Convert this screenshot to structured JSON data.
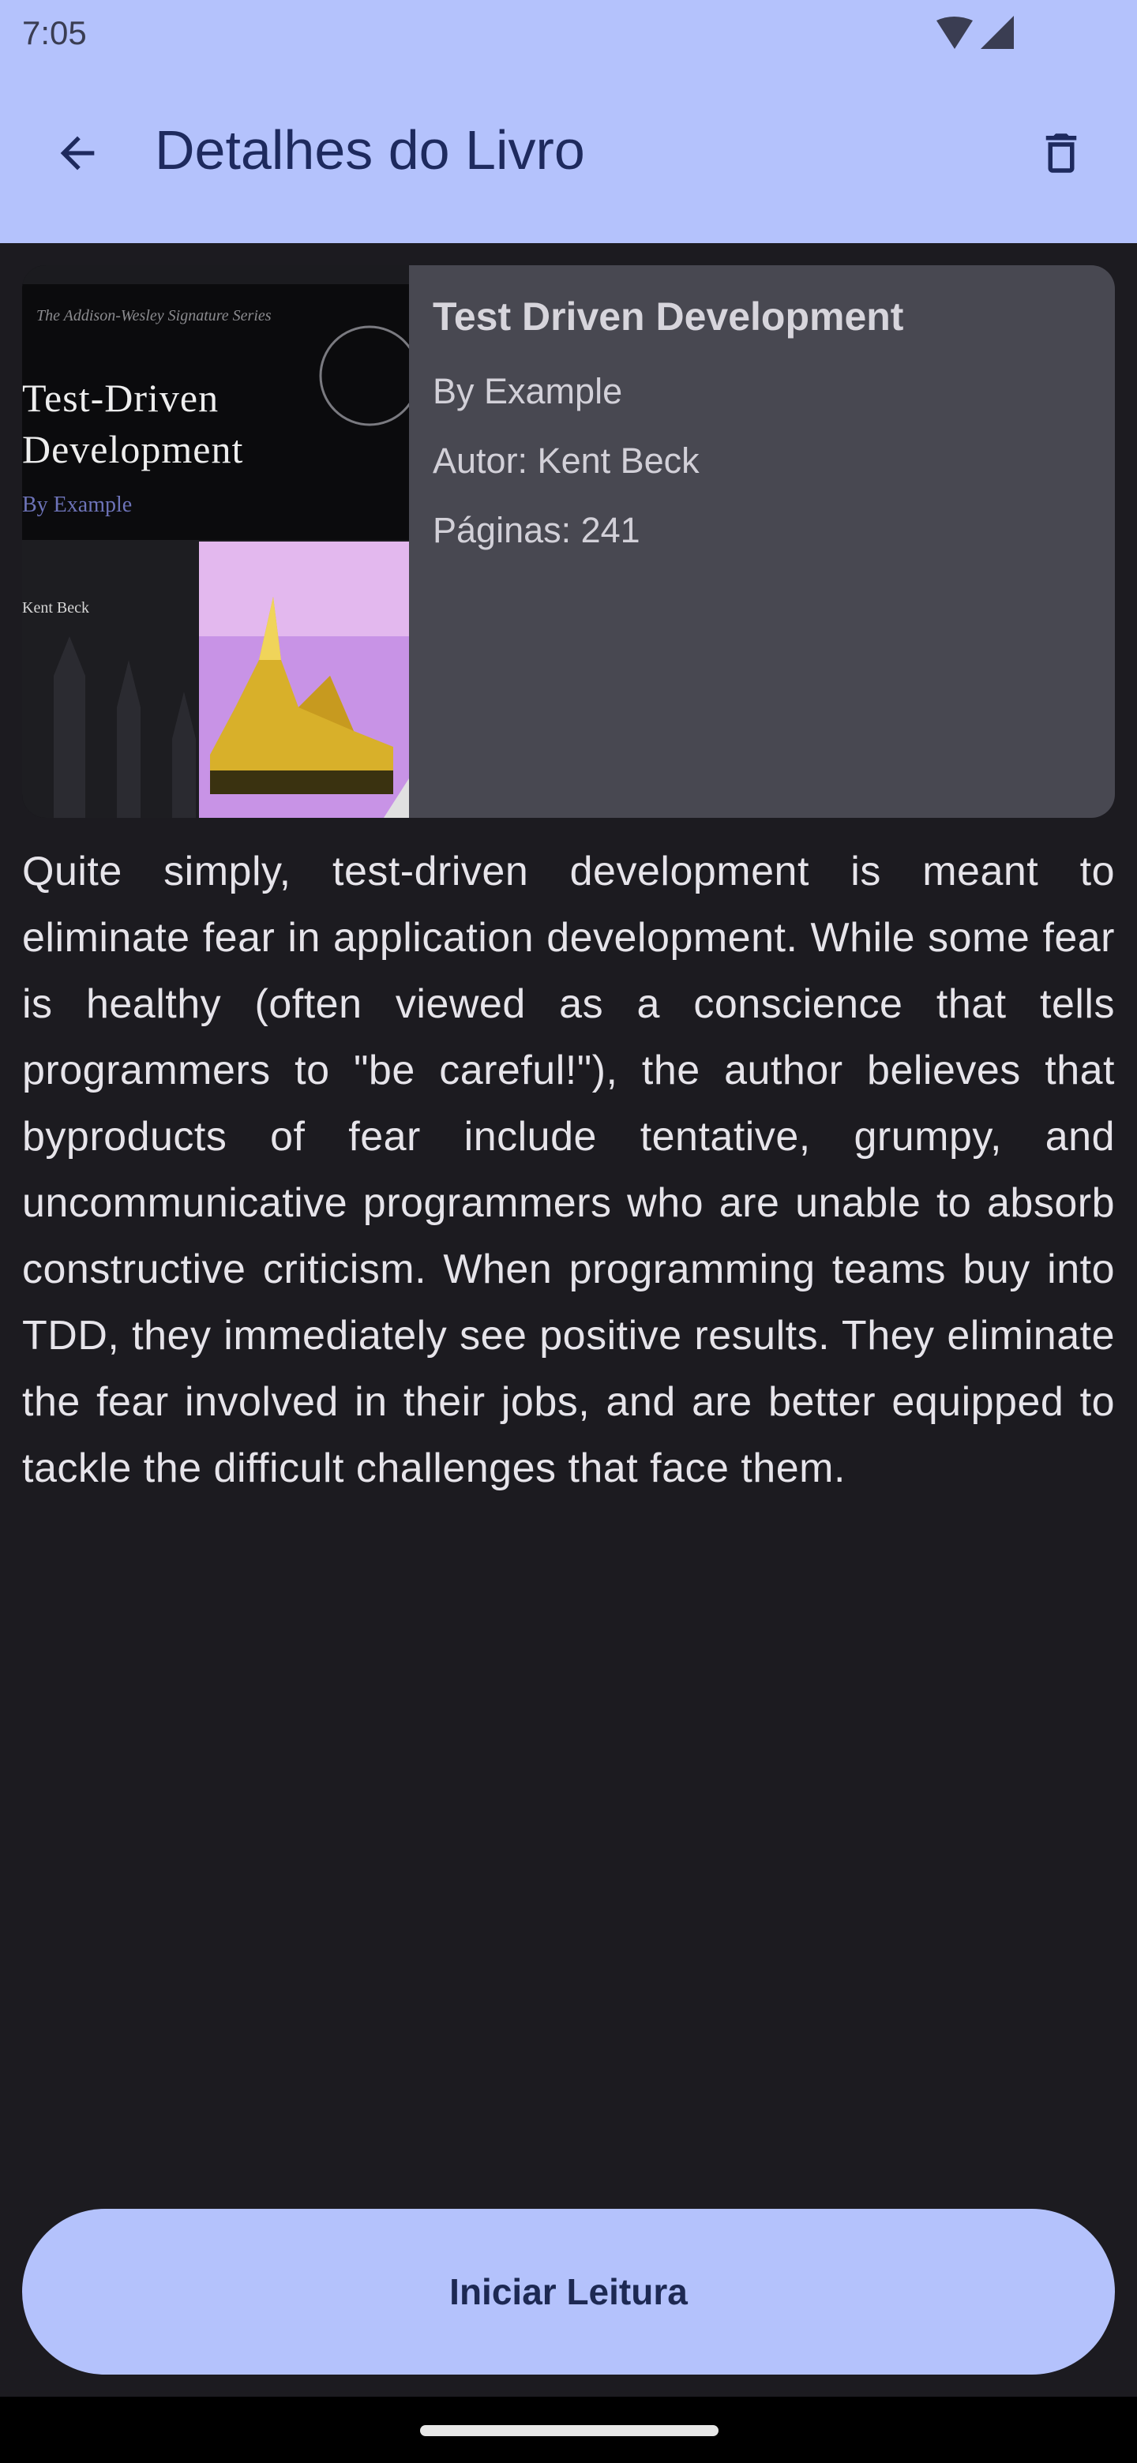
{
  "status_bar": {
    "time": "7:05",
    "icons": [
      "wifi-icon",
      "signal-icon"
    ]
  },
  "app_bar": {
    "title": "Detalhes do Livro",
    "back_icon": "arrow-back-icon",
    "delete_icon": "trash-icon"
  },
  "book": {
    "title": "Test Driven Development",
    "subtitle": "By Example",
    "author_line": "Autor: Kent Beck",
    "pages_line": "Páginas: 241",
    "cover": {
      "series": "The Addison-Wesley Signature Series",
      "title_line1": "Test-Driven",
      "title_line2": "Development",
      "subtitle": "By Example",
      "author": "Kent Beck"
    },
    "description": "Quite simply, test-driven development is meant to eliminate fear in application development. While some fear is healthy (often viewed as a conscience that tells programmers to \"be careful!\"), the author believes that byproducts of fear include tentative, grumpy, and uncommunicative programmers who are unable to absorb constructive criticism. When programming teams buy into TDD, they immediately see positive results. They eliminate the fear involved in their jobs, and are better equipped to tackle the difficult challenges that face them."
  },
  "actions": {
    "start_reading": "Iniciar Leitura"
  },
  "colors": {
    "accent": "#b4c2fc",
    "on_accent": "#1e2a5e",
    "background": "#1c1b20",
    "card": "#484851"
  }
}
